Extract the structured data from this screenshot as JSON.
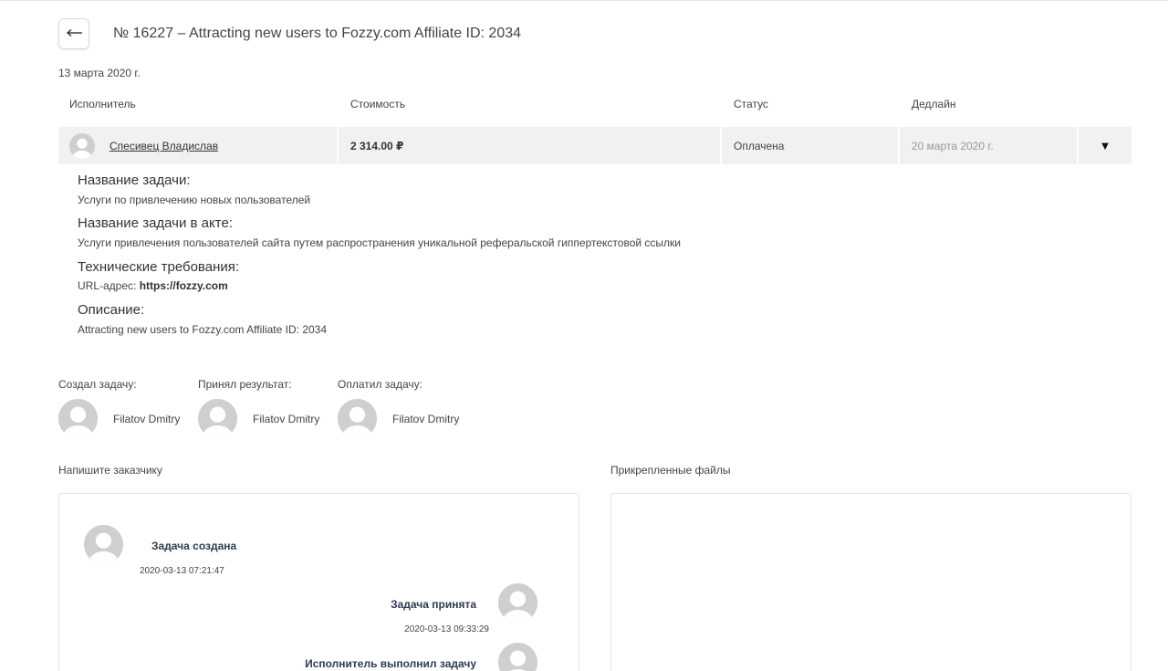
{
  "header": {
    "title": "№ 16227 – Attracting new users to Fozzy.com Affiliate ID: 2034",
    "date": "13 марта 2020 г."
  },
  "table": {
    "columns": [
      "Исполнитель",
      "Стоимость",
      "Статус",
      "Дедлайн"
    ],
    "row": {
      "executor": "Спесивец Владислав",
      "cost": "2 314.00 ₽",
      "status": "Оплачена",
      "deadline": "20 марта 2020 г.",
      "toggle": "▼"
    }
  },
  "details": {
    "task_name_label": "Название задачи:",
    "task_name": "Услуги по привлечению новых пользователей",
    "act_name_label": "Название задачи в акте:",
    "act_name": "Услуги привлечения пользователей сайта путем распространения уникальной реферальской гиппертекстовой ссылки",
    "tech_label": "Технические требования:",
    "url_prefix": "URL-адрес: ",
    "url": "https://fozzy.com",
    "desc_label": "Описание:",
    "desc": "Attracting new users to Fozzy.com Affiliate ID: 2034"
  },
  "people": [
    {
      "label": "Создал задачу:",
      "name": "Filatov Dmitry"
    },
    {
      "label": "Принял результат:",
      "name": "Filatov Dmitry"
    },
    {
      "label": "Оплатил задачу:",
      "name": "Filatov Dmitry"
    }
  ],
  "chat": {
    "label": "Напишите заказчику",
    "messages": [
      {
        "title": "Задача создана",
        "time": "2020-03-13 07:21:47"
      },
      {
        "title": "Задача принята",
        "time": "2020-03-13 09:33:29"
      },
      {
        "title": "Исполнитель выполнил задачу",
        "time": ""
      }
    ]
  },
  "files": {
    "label": "Прикрепленные файлы"
  },
  "icons": {
    "back": "arrow-left-icon",
    "avatar": "user-placeholder-icon",
    "toggle": "triangle-down-icon"
  }
}
